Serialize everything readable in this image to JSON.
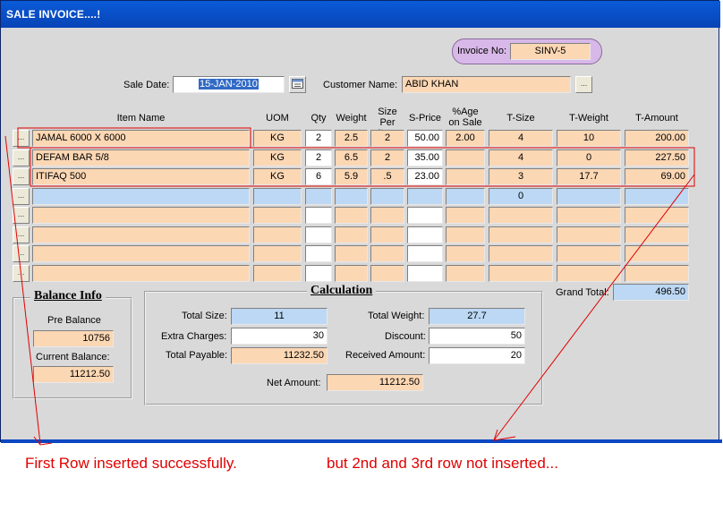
{
  "window": {
    "title": "SALE INVOICE....!"
  },
  "invoice": {
    "label": "Invoice No:",
    "value": "SINV-5"
  },
  "sale_date": {
    "label": "Sale Date:",
    "value": "15-JAN-2010"
  },
  "customer": {
    "label": "Customer Name:",
    "value": "ABID KHAN"
  },
  "lookup_button": "...",
  "grid": {
    "headers": {
      "item_name": "Item Name",
      "uom": "UOM",
      "qty": "Qty",
      "weight": "Weight",
      "size_per_item": "Size Per Item",
      "s_price": "S-Price",
      "age_on_sale": "%Age on Sale",
      "t_size": "T-Size",
      "t_weight": "T-Weight",
      "t_amount": "T-Amount"
    },
    "rows": [
      {
        "item": "JAMAL 6000 X 6000",
        "uom": "KG",
        "qty": "2",
        "weight": "2.5",
        "size": "2",
        "price": "50.00",
        "age": "2.00",
        "tsize": "4",
        "tweight": "10",
        "tamount": "200.00"
      },
      {
        "item": "DEFAM BAR 5/8",
        "uom": "KG",
        "qty": "2",
        "weight": "6.5",
        "size": "2",
        "price": "35.00",
        "age": "",
        "tsize": "4",
        "tweight": "0",
        "tamount": "227.50"
      },
      {
        "item": "ITIFAQ 500",
        "uom": "KG",
        "qty": "6",
        "weight": "5.9",
        "size": ".5",
        "price": "23.00",
        "age": "",
        "tsize": "3",
        "tweight": "17.7",
        "tamount": "69.00"
      },
      {
        "item": "",
        "uom": "",
        "qty": "",
        "weight": "",
        "size": "",
        "price": "",
        "age": "",
        "tsize": "0",
        "tweight": "",
        "tamount": ""
      },
      {
        "item": "",
        "uom": "",
        "qty": "",
        "weight": "",
        "size": "",
        "price": "",
        "age": "",
        "tsize": "",
        "tweight": "",
        "tamount": ""
      },
      {
        "item": "",
        "uom": "",
        "qty": "",
        "weight": "",
        "size": "",
        "price": "",
        "age": "",
        "tsize": "",
        "tweight": "",
        "tamount": ""
      },
      {
        "item": "",
        "uom": "",
        "qty": "",
        "weight": "",
        "size": "",
        "price": "",
        "age": "",
        "tsize": "",
        "tweight": "",
        "tamount": ""
      },
      {
        "item": "",
        "uom": "",
        "qty": "",
        "weight": "",
        "size": "",
        "price": "",
        "age": "",
        "tsize": "",
        "tweight": "",
        "tamount": ""
      }
    ]
  },
  "grand_total": {
    "label": "Grand Total:",
    "value": "496.50"
  },
  "balance_info": {
    "title": "Balance Info",
    "pre_balance_label": "Pre Balance",
    "pre_balance": "10756",
    "current_balance_label": "Current Balance:",
    "current_balance": "11212.50"
  },
  "calculation": {
    "title": "Calculation",
    "total_size_label": "Total Size:",
    "total_size": "11",
    "total_weight_label": "Total Weight:",
    "total_weight": "27.7",
    "extra_charges_label": "Extra Charges:",
    "extra_charges": "30",
    "discount_label": "Discount:",
    "discount": "50",
    "total_payable_label": "Total Payable:",
    "total_payable": "11232.50",
    "received_amount_label": "Received Amount:",
    "received_amount": "20",
    "net_amount_label": "Net Amount:",
    "net_amount": "11212.50"
  },
  "annotations": {
    "left_note": "First  Row inserted successfully.",
    "right_note": "but 2nd and 3rd row not inserted...",
    "color": "#e00000"
  },
  "colors": {
    "title_bar": "#0a5bd8",
    "field_peach": "#fcd7b4",
    "field_blue": "#bcd8f4",
    "invoice_pill": "#d8b8e8",
    "window_bg": "#d9d9d9"
  }
}
